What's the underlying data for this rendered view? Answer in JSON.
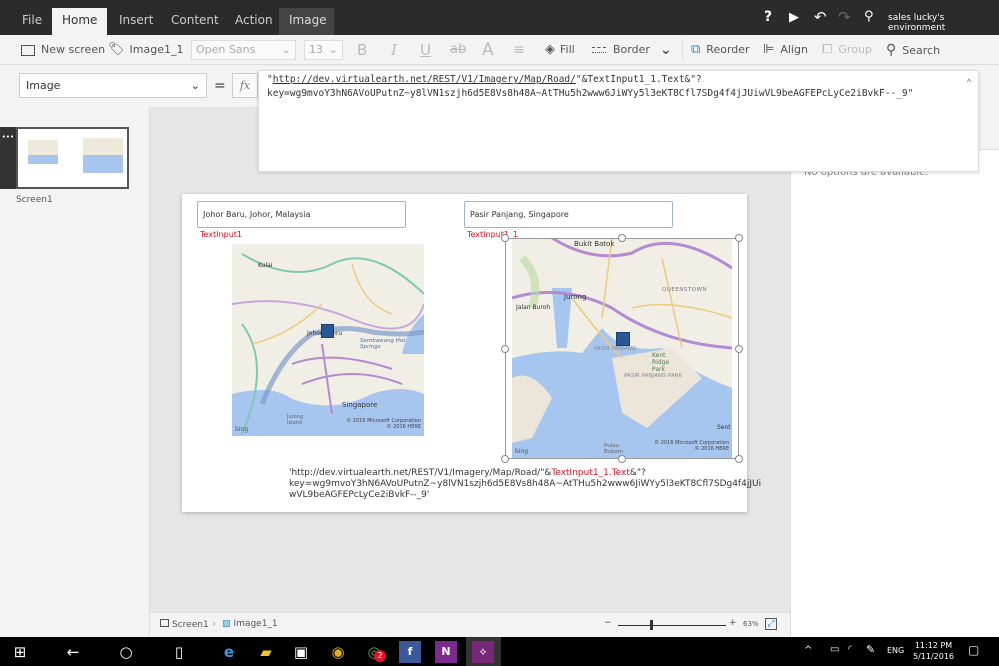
{
  "ribbon": {
    "tabs": [
      {
        "label": "File"
      },
      {
        "label": "Home",
        "active": true
      },
      {
        "label": "Insert"
      },
      {
        "label": "Content"
      },
      {
        "label": "Action"
      },
      {
        "label": "Image",
        "contextual": true
      }
    ],
    "environment": "sales lucky's environment"
  },
  "toolbar": {
    "new_screen": "New screen",
    "control_name": "Image1_1",
    "font": "Open Sans",
    "font_size": "13",
    "bold": "B",
    "italic": "I",
    "underline": "U",
    "strike": "ab",
    "font_color": "A",
    "fill": "Fill",
    "border": "Border",
    "reorder": "Reorder",
    "align": "Align",
    "group": "Group",
    "search": "Search"
  },
  "formula_bar": {
    "property": "Image",
    "equals": "=",
    "fx": "fx",
    "formula_q1": "\"",
    "formula_url": "http://dev.virtualearth.net/REST/V1/Imagery/Map/Road/",
    "formula_rest": "\"&TextInput1_1.Text&\"?",
    "formula_line2": "key=wg9mvoY3hN6AVoUPutnZ~y8lVN1szjh6d5E8Vs8h48A~AtTHu5h2www6JiWYy5l3eKT8Cfl7SDg4f4jJUiwVL9beAGFEPcLyCe2iBvkF--_9\""
  },
  "screens_panel": {
    "screens": [
      {
        "label": "Screen1"
      }
    ],
    "more": "•••"
  },
  "right_panel": {
    "message": "No options are available."
  },
  "canvas": {
    "input1": {
      "value": "Johor Baru, Johor, Malaysia",
      "name": "TextInput1"
    },
    "input2": {
      "value": "Pasir Panjang, Singapore",
      "name": "TextInput1_1"
    },
    "map1": {
      "labels": [
        "Kulai",
        "Johor Bahru",
        "Sembawang Hot Springs",
        "Singapore",
        "Jurong Island"
      ],
      "attribution1": "© 2016 Microsoft Corporation",
      "attribution2": "© 2016 HERE",
      "brand": "bing"
    },
    "map2": {
      "labels": [
        "Bukit Batok",
        "Jurong",
        "Jalan Buroh",
        "QUEENSTOWN",
        "PASIR PANJANG",
        "Kent Ridge Park",
        "PASIR PANJANG PARK",
        "Pulau Bukom",
        "Sent"
      ],
      "attribution1": "© 2016 Microsoft Corporation",
      "attribution2": "© 2016 HERE",
      "brand": "bing"
    },
    "label_text": {
      "part1": "'http://dev.virtualearth.net/REST/V1/Imagery/Map/Road/\"&",
      "highlight": "TextInput1_1.Text",
      "part2": "&\"?",
      "line2": "key=wg9mvoY3hN6AVoUPutnZ~y8lVN1szjh6d5E8Vs8h48A~AtTHu5h2www6JiWYy5l3eKT8Cfl7SDg4f4jJUi",
      "line3": "wVL9beAGFEPcLyCe2iBvkF--_9'"
    }
  },
  "statusbar": {
    "screen": "Screen1",
    "control": "Image1_1",
    "zoom_minus": "−",
    "zoom_plus": "+",
    "zoom": "63%",
    "zoom_level": 63
  },
  "taskbar": {
    "time": "11:12 PM",
    "date": "5/11/2016",
    "lang": "ENG",
    "whatsapp_badge": "2"
  },
  "colors": {
    "accent": "#e81123",
    "dark": "#2b2b2b",
    "water": "#a6c5ef",
    "pin": "#2b5797"
  }
}
